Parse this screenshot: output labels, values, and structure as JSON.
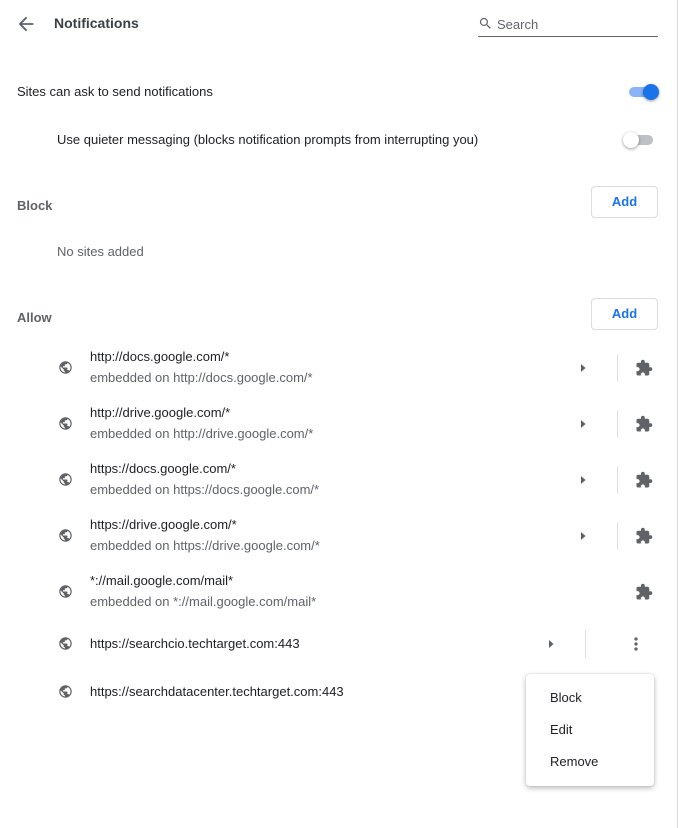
{
  "header": {
    "title": "Notifications",
    "back_icon": "arrow-back-icon",
    "search": {
      "placeholder": "Search",
      "value": "",
      "icon": "search-icon"
    }
  },
  "settings": {
    "ask_label": "Sites can ask to send notifications",
    "ask_enabled": true,
    "quiet_label": "Use quieter messaging (blocks notification prompts from interrupting you)",
    "quiet_enabled": false
  },
  "block": {
    "title": "Block",
    "add_label": "Add",
    "empty_text": "No sites added"
  },
  "allow": {
    "title": "Allow",
    "add_label": "Add",
    "sites": [
      {
        "url": "http://docs.google.com/*",
        "embedded": "embedded on http://docs.google.com/*"
      },
      {
        "url": "http://drive.google.com/*",
        "embedded": "embedded on http://drive.google.com/*"
      },
      {
        "url": "https://docs.google.com/*",
        "embedded": "embedded on https://docs.google.com/*"
      },
      {
        "url": "https://drive.google.com/*",
        "embedded": "embedded on https://drive.google.com/*"
      },
      {
        "url": "*://mail.google.com/mail*",
        "embedded": "embedded on *://mail.google.com/mail*"
      },
      {
        "url": "https://searchcio.techtarget.com:443"
      },
      {
        "url": "https://searchdatacenter.techtarget.com:443"
      }
    ]
  },
  "context_menu": {
    "items": [
      "Block",
      "Edit",
      "Remove"
    ]
  },
  "colors": {
    "accent": "#1a73e8",
    "toggle_track_on": "#8ab4f8",
    "icon_gray": "#5f6368"
  }
}
